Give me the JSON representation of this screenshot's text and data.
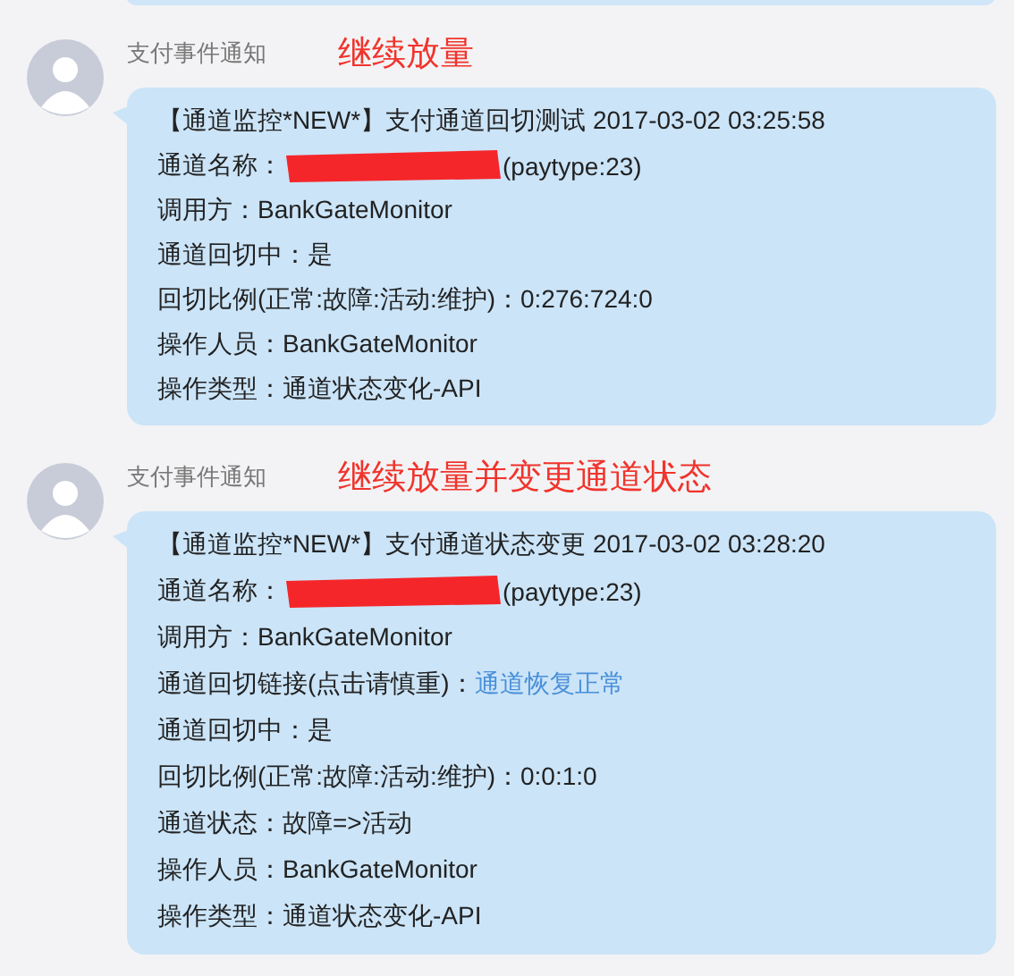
{
  "messages": [
    {
      "sender": "支付事件通知",
      "annotation": "继续放量",
      "lines": [
        {
          "kind": "text",
          "label": "【通道监控*NEW*】支付通道回切测试 2017-03-02 03:25:58"
        },
        {
          "kind": "redacted",
          "label": "通道名称：",
          "value": "(paytype:23)"
        },
        {
          "kind": "text",
          "label": "调用方：BankGateMonitor"
        },
        {
          "kind": "text",
          "label": "通道回切中：是"
        },
        {
          "kind": "text",
          "label": "回切比例(正常:故障:活动:维护)：0:276:724:0"
        },
        {
          "kind": "text",
          "label": "操作人员：BankGateMonitor"
        },
        {
          "kind": "text",
          "label": "操作类型：通道状态变化-API"
        }
      ]
    },
    {
      "sender": "支付事件通知",
      "annotation": "继续放量并变更通道状态",
      "lines": [
        {
          "kind": "text",
          "label": "【通道监控*NEW*】支付通道状态变更 2017-03-02 03:28:20"
        },
        {
          "kind": "redacted",
          "label": "通道名称：",
          "value": "(paytype:23)"
        },
        {
          "kind": "text",
          "label": "调用方：BankGateMonitor"
        },
        {
          "kind": "link",
          "label": "通道回切链接(点击请慎重)：",
          "value": "通道恢复正常"
        },
        {
          "kind": "text",
          "label": "通道回切中：是"
        },
        {
          "kind": "text",
          "label": "回切比例(正常:故障:活动:维护)：0:0:1:0"
        },
        {
          "kind": "text",
          "label": "通道状态：故障=>活动"
        },
        {
          "kind": "text",
          "label": "操作人员：BankGateMonitor"
        },
        {
          "kind": "text",
          "label": "操作类型：通道状态变化-API"
        }
      ]
    }
  ]
}
